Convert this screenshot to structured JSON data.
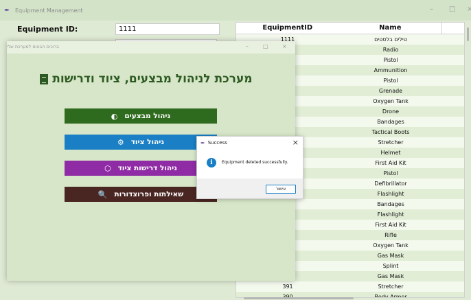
{
  "back_window": {
    "title": "Equipment Management",
    "controls": {
      "minimize": "–",
      "maximize": "□",
      "close": "×"
    },
    "form": {
      "equipment_id_label": "Equipment ID:",
      "equipment_id_value": "1111"
    },
    "table": {
      "columns": [
        "EquipmentID",
        "Name"
      ],
      "rows": [
        {
          "id": "1111",
          "name": "טילים בלסטים"
        },
        {
          "id": "",
          "name": "Radio"
        },
        {
          "id": "",
          "name": "Pistol"
        },
        {
          "id": "",
          "name": "Ammunition"
        },
        {
          "id": "",
          "name": "Pistol"
        },
        {
          "id": "",
          "name": "Grenade"
        },
        {
          "id": "",
          "name": "Oxygen Tank"
        },
        {
          "id": "",
          "name": "Drone"
        },
        {
          "id": "",
          "name": "Bandages"
        },
        {
          "id": "",
          "name": "Tactical Boots"
        },
        {
          "id": "",
          "name": "Stretcher"
        },
        {
          "id": "",
          "name": "Helmet"
        },
        {
          "id": "",
          "name": "First Aid Kit"
        },
        {
          "id": "",
          "name": "Pistol"
        },
        {
          "id": "",
          "name": "Defibrillator"
        },
        {
          "id": "",
          "name": "Flashlight"
        },
        {
          "id": "",
          "name": "Bandages"
        },
        {
          "id": "",
          "name": "Flashlight"
        },
        {
          "id": "",
          "name": "First Aid Kit"
        },
        {
          "id": "",
          "name": "Rifle"
        },
        {
          "id": "",
          "name": "Oxygen Tank"
        },
        {
          "id": "",
          "name": "Gas Mask"
        },
        {
          "id": "",
          "name": "Splint"
        },
        {
          "id": "",
          "name": "Gas Mask"
        },
        {
          "id": "391",
          "name": "Stretcher"
        },
        {
          "id": "390",
          "name": "Body Armor"
        }
      ]
    }
  },
  "menu_window": {
    "title": "ברוכים הבאים למערכת שלי",
    "controls": {
      "minimize": "–",
      "maximize": "□",
      "close": "×"
    },
    "heading": "מערכת לניהול מבצעים, ציוד ודרישות",
    "heading_icon": "clipboard-icon",
    "buttons": [
      {
        "label": "ניהול מבצעים",
        "icon": "◐",
        "icon_name": "half-circle-icon",
        "color": "#2f6b1f"
      },
      {
        "label": "ניהול ציוד",
        "icon": "⚙",
        "icon_name": "gear-icon",
        "color": "#1a7fc4"
      },
      {
        "label": "ניהול דרישות ציוד",
        "icon": "⬡",
        "icon_name": "package-icon",
        "color": "#8f2ba5"
      },
      {
        "label": "שאילתות ופרוצדורות",
        "icon": "🔍",
        "icon_name": "search-icon",
        "color": "#4a2623"
      }
    ]
  },
  "dialog": {
    "title": "Success",
    "close": "×",
    "message": "Equipment deleted successfully.",
    "ok_label": "אישור",
    "info_glyph": "i"
  }
}
